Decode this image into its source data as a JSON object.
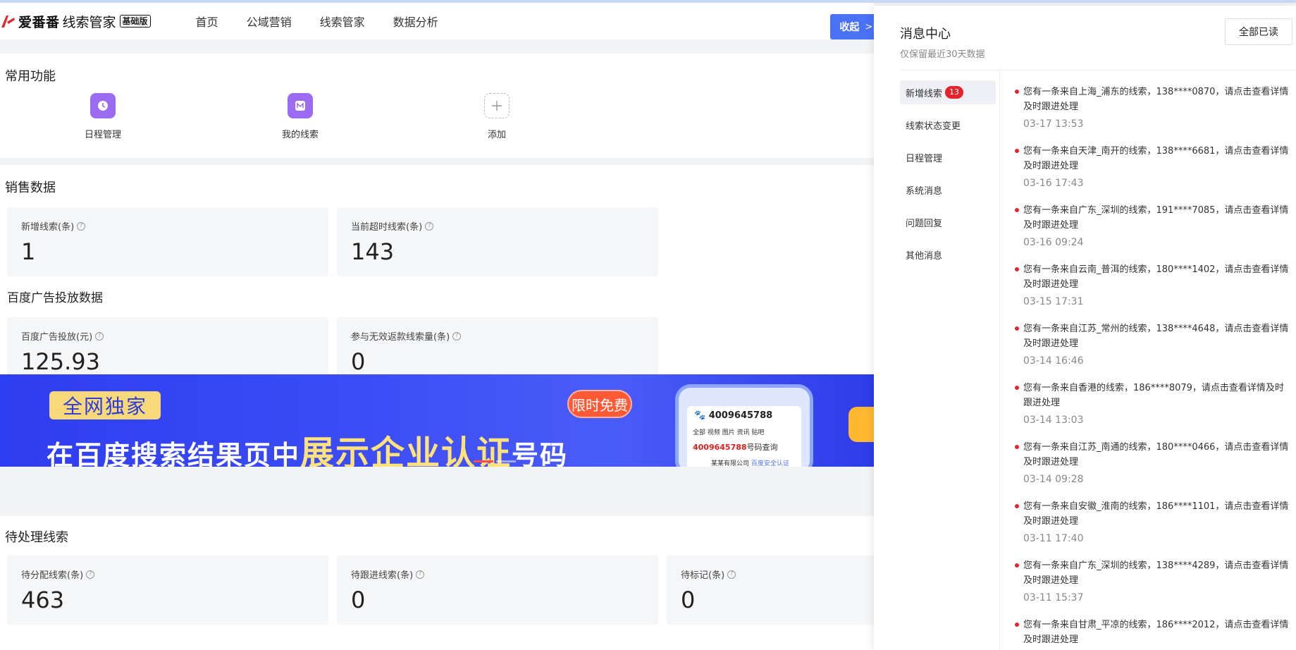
{
  "brand": {
    "name": "爱番番",
    "product": "线索管家",
    "edition": "基础版"
  },
  "nav": [
    "首页",
    "公域营销",
    "线索管家",
    "数据分析"
  ],
  "collapse_label": "收起",
  "quick": {
    "title": "常用功能",
    "items": [
      {
        "label": "日程管理",
        "icon": "clock-icon"
      },
      {
        "label": "我的线索",
        "icon": "leads-icon"
      },
      {
        "label": "添加",
        "icon": "plus-icon"
      }
    ]
  },
  "sales": {
    "title": "销售数据",
    "stats": [
      {
        "label": "新增线索(条)",
        "value": "1"
      },
      {
        "label": "当前超时线索(条)",
        "value": "143"
      }
    ],
    "baidu_title": "百度广告投放数据",
    "baidu_stats": [
      {
        "label": "百度广告投放(元)",
        "value": "125.93"
      },
      {
        "label": "参与无效返款线索量(条)",
        "value": "0"
      }
    ]
  },
  "banner": {
    "tag": "全网独家",
    "text_before": "在百度搜索结果页中",
    "text_highlight": "展示企业认证",
    "text_after": "号码",
    "free": "限时免费",
    "phone_number": "4009645788",
    "phone_tabs": "全部  视频  图片  资讯  贴吧",
    "phone_query": "4009645788",
    "phone_query_suffix": "号码查询",
    "phone_company": "某某有限公司",
    "phone_cert": "百度安全认证"
  },
  "pending": {
    "title": "待处理线索",
    "stats": [
      {
        "label": "待分配线索(条)",
        "value": "463"
      },
      {
        "label": "待跟进线索(条)",
        "value": "0"
      },
      {
        "label": "待标记(条)",
        "value": "0"
      }
    ]
  },
  "panel": {
    "title": "消息中心",
    "subtitle": "仅保留最近30天数据",
    "mark_all": "全部已读",
    "categories": [
      {
        "label": "新增线索",
        "badge": "13"
      },
      {
        "label": "线索状态变更"
      },
      {
        "label": "日程管理"
      },
      {
        "label": "系统消息"
      },
      {
        "label": "问题回复"
      },
      {
        "label": "其他消息"
      }
    ],
    "messages": [
      {
        "text": "您有一条来自上海_浦东的线索，138****0870，请点击查看详情及时跟进处理",
        "time": "03-17 13:53"
      },
      {
        "text": "您有一条来自天津_南开的线索，138****6681，请点击查看详情及时跟进处理",
        "time": "03-16 17:43"
      },
      {
        "text": "您有一条来自广东_深圳的线索，191****7085，请点击查看详情及时跟进处理",
        "time": "03-16 09:24"
      },
      {
        "text": "您有一条来自云南_普洱的线索，180****1402，请点击查看详情及时跟进处理",
        "time": "03-15 17:31"
      },
      {
        "text": "您有一条来自江苏_常州的线索，138****4648，请点击查看详情及时跟进处理",
        "time": "03-14 16:46"
      },
      {
        "text": "您有一条来自香港的线索，186****8079，请点击查看详情及时跟进处理",
        "time": "03-14 13:03"
      },
      {
        "text": "您有一条来自江苏_南通的线索，180****0466，请点击查看详情及时跟进处理",
        "time": "03-14 09:28"
      },
      {
        "text": "您有一条来自安徽_淮南的线索，186****1101，请点击查看详情及时跟进处理",
        "time": "03-11 17:40"
      },
      {
        "text": "您有一条来自广东_深圳的线索，138****4289，请点击查看详情及时跟进处理",
        "time": "03-11 15:37"
      },
      {
        "text": "您有一条来自甘肃_平凉的线索，186****2012，请点击查看详情及时跟进处理",
        "time": ""
      }
    ]
  }
}
